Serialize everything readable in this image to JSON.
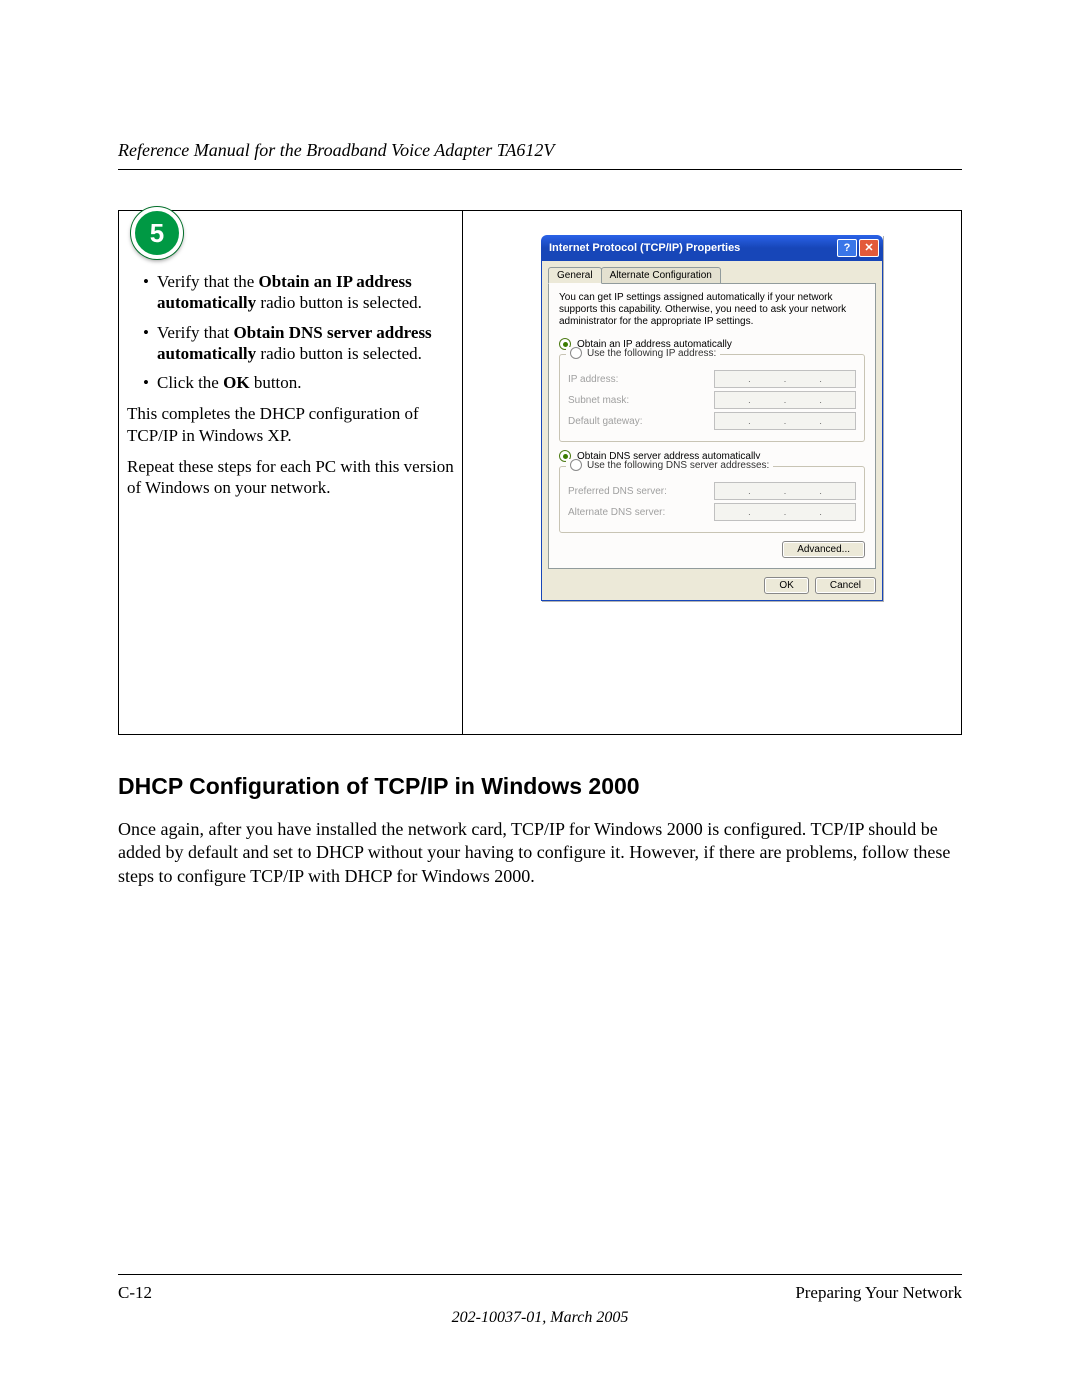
{
  "header": {
    "title": "Reference Manual for the Broadband Voice Adapter TA612V"
  },
  "step": {
    "number": "5",
    "bullets": [
      {
        "pre": "Verify that the ",
        "bold": "Obtain an IP address automatically",
        "post": " radio button is selected."
      },
      {
        "pre": "Verify that ",
        "bold": "Obtain DNS server address automatically",
        "post": " radio button is selected."
      },
      {
        "pre": "Click the ",
        "bold": "OK",
        "post": " button."
      }
    ],
    "para1": "This completes the DHCP configuration of TCP/IP in Windows XP.",
    "para2": "Repeat these steps for each PC with this version of Windows on your network."
  },
  "dialog": {
    "title": "Internet Protocol (TCP/IP) Properties",
    "tabs": {
      "active": "General",
      "inactive": "Alternate Configuration"
    },
    "desc": "You can get IP settings assigned automatically if your network supports this capability. Otherwise, you need to ask your network administrator for the appropriate IP settings.",
    "radio_ip_auto": "Obtain an IP address automatically",
    "radio_ip_manual": "Use the following IP address:",
    "ip_labels": {
      "ip": "IP address:",
      "mask": "Subnet mask:",
      "gw": "Default gateway:"
    },
    "radio_dns_auto": "Obtain DNS server address automatically",
    "radio_dns_manual": "Use the following DNS server addresses:",
    "dns_labels": {
      "pref": "Preferred DNS server:",
      "alt": "Alternate DNS server:"
    },
    "buttons": {
      "advanced": "Advanced...",
      "ok": "OK",
      "cancel": "Cancel"
    }
  },
  "section": {
    "title": "DHCP Configuration of TCP/IP in Windows 2000",
    "body": "Once again, after you have installed the network card, TCP/IP for Windows 2000 is configured. TCP/IP should be added by default and set to DHCP without your having to configure it. However, if there are problems, follow these steps to configure TCP/IP with DHCP for Windows 2000."
  },
  "footer": {
    "left": "C-12",
    "right": "Preparing Your Network",
    "sub": "202-10037-01, March 2005"
  }
}
